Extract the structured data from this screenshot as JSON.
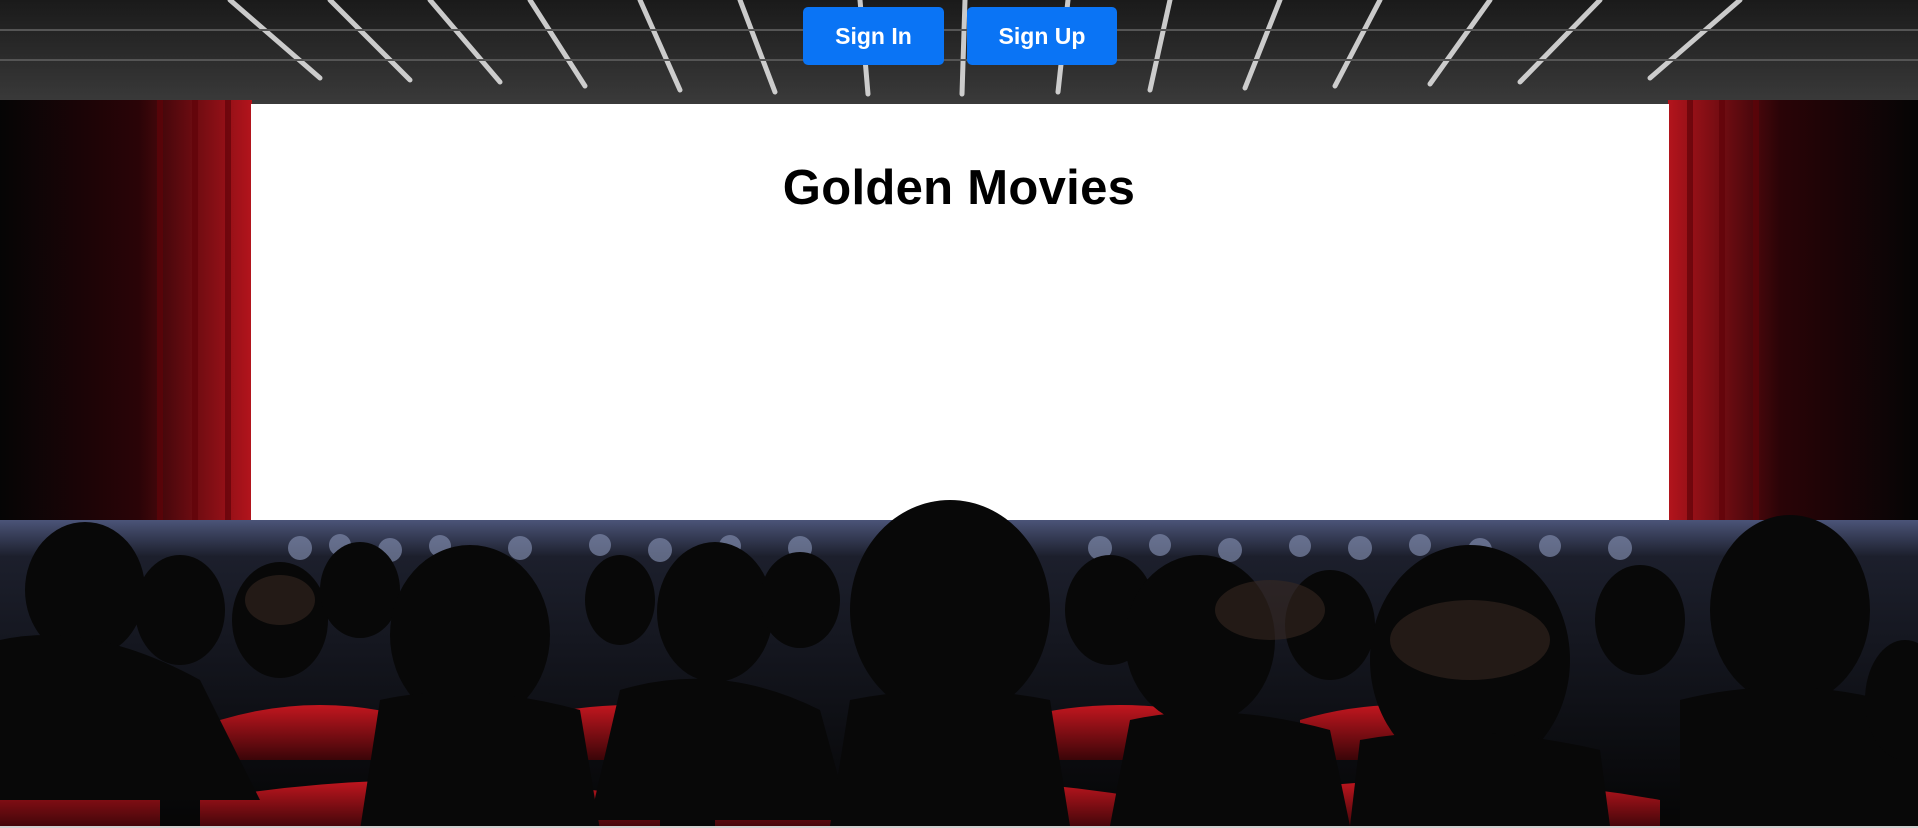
{
  "header": {
    "sign_in_label": "Sign In",
    "sign_up_label": "Sign Up"
  },
  "main": {
    "title": "Golden Movies"
  },
  "colors": {
    "button_bg": "#0a74f5",
    "button_text": "#ffffff",
    "screen": "#ffffff",
    "curtain": "#a4141b",
    "seat": "#8e1016"
  },
  "hero_image": {
    "icon": "cinema-audience-image"
  }
}
